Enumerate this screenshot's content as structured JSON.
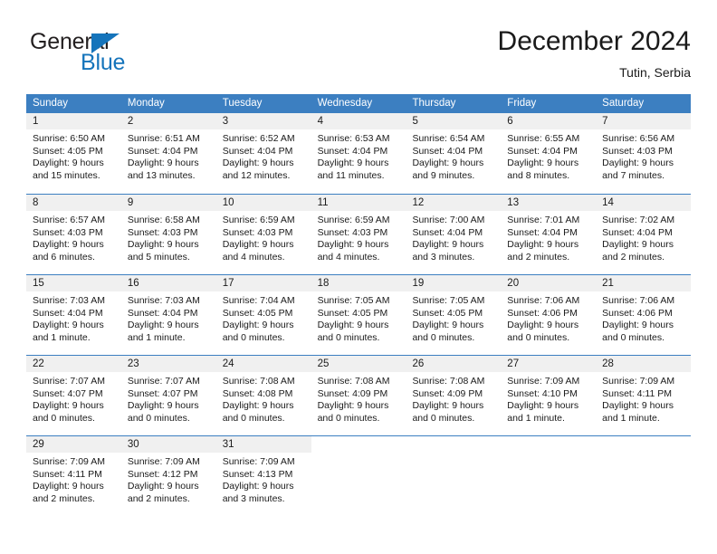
{
  "logo": {
    "primary_text": "General",
    "secondary_text": "Blue",
    "primary_color": "#231f20",
    "secondary_color": "#1574bb"
  },
  "header": {
    "month_title": "December 2024",
    "location": "Tutin, Serbia"
  },
  "theme": {
    "header_bg": "#3c7fc1",
    "header_text": "#ffffff",
    "day_band_bg": "#f0f0f0",
    "cell_bg": "#ffffff",
    "text": "#1a1a1a"
  },
  "calendar": {
    "weekdays": [
      "Sunday",
      "Monday",
      "Tuesday",
      "Wednesday",
      "Thursday",
      "Friday",
      "Saturday"
    ],
    "weeks": [
      [
        {
          "day": "1",
          "lines": [
            "Sunrise: 6:50 AM",
            "Sunset: 4:05 PM",
            "Daylight: 9 hours",
            "and 15 minutes."
          ]
        },
        {
          "day": "2",
          "lines": [
            "Sunrise: 6:51 AM",
            "Sunset: 4:04 PM",
            "Daylight: 9 hours",
            "and 13 minutes."
          ]
        },
        {
          "day": "3",
          "lines": [
            "Sunrise: 6:52 AM",
            "Sunset: 4:04 PM",
            "Daylight: 9 hours",
            "and 12 minutes."
          ]
        },
        {
          "day": "4",
          "lines": [
            "Sunrise: 6:53 AM",
            "Sunset: 4:04 PM",
            "Daylight: 9 hours",
            "and 11 minutes."
          ]
        },
        {
          "day": "5",
          "lines": [
            "Sunrise: 6:54 AM",
            "Sunset: 4:04 PM",
            "Daylight: 9 hours",
            "and 9 minutes."
          ]
        },
        {
          "day": "6",
          "lines": [
            "Sunrise: 6:55 AM",
            "Sunset: 4:04 PM",
            "Daylight: 9 hours",
            "and 8 minutes."
          ]
        },
        {
          "day": "7",
          "lines": [
            "Sunrise: 6:56 AM",
            "Sunset: 4:03 PM",
            "Daylight: 9 hours",
            "and 7 minutes."
          ]
        }
      ],
      [
        {
          "day": "8",
          "lines": [
            "Sunrise: 6:57 AM",
            "Sunset: 4:03 PM",
            "Daylight: 9 hours",
            "and 6 minutes."
          ]
        },
        {
          "day": "9",
          "lines": [
            "Sunrise: 6:58 AM",
            "Sunset: 4:03 PM",
            "Daylight: 9 hours",
            "and 5 minutes."
          ]
        },
        {
          "day": "10",
          "lines": [
            "Sunrise: 6:59 AM",
            "Sunset: 4:03 PM",
            "Daylight: 9 hours",
            "and 4 minutes."
          ]
        },
        {
          "day": "11",
          "lines": [
            "Sunrise: 6:59 AM",
            "Sunset: 4:03 PM",
            "Daylight: 9 hours",
            "and 4 minutes."
          ]
        },
        {
          "day": "12",
          "lines": [
            "Sunrise: 7:00 AM",
            "Sunset: 4:04 PM",
            "Daylight: 9 hours",
            "and 3 minutes."
          ]
        },
        {
          "day": "13",
          "lines": [
            "Sunrise: 7:01 AM",
            "Sunset: 4:04 PM",
            "Daylight: 9 hours",
            "and 2 minutes."
          ]
        },
        {
          "day": "14",
          "lines": [
            "Sunrise: 7:02 AM",
            "Sunset: 4:04 PM",
            "Daylight: 9 hours",
            "and 2 minutes."
          ]
        }
      ],
      [
        {
          "day": "15",
          "lines": [
            "Sunrise: 7:03 AM",
            "Sunset: 4:04 PM",
            "Daylight: 9 hours",
            "and 1 minute."
          ]
        },
        {
          "day": "16",
          "lines": [
            "Sunrise: 7:03 AM",
            "Sunset: 4:04 PM",
            "Daylight: 9 hours",
            "and 1 minute."
          ]
        },
        {
          "day": "17",
          "lines": [
            "Sunrise: 7:04 AM",
            "Sunset: 4:05 PM",
            "Daylight: 9 hours",
            "and 0 minutes."
          ]
        },
        {
          "day": "18",
          "lines": [
            "Sunrise: 7:05 AM",
            "Sunset: 4:05 PM",
            "Daylight: 9 hours",
            "and 0 minutes."
          ]
        },
        {
          "day": "19",
          "lines": [
            "Sunrise: 7:05 AM",
            "Sunset: 4:05 PM",
            "Daylight: 9 hours",
            "and 0 minutes."
          ]
        },
        {
          "day": "20",
          "lines": [
            "Sunrise: 7:06 AM",
            "Sunset: 4:06 PM",
            "Daylight: 9 hours",
            "and 0 minutes."
          ]
        },
        {
          "day": "21",
          "lines": [
            "Sunrise: 7:06 AM",
            "Sunset: 4:06 PM",
            "Daylight: 9 hours",
            "and 0 minutes."
          ]
        }
      ],
      [
        {
          "day": "22",
          "lines": [
            "Sunrise: 7:07 AM",
            "Sunset: 4:07 PM",
            "Daylight: 9 hours",
            "and 0 minutes."
          ]
        },
        {
          "day": "23",
          "lines": [
            "Sunrise: 7:07 AM",
            "Sunset: 4:07 PM",
            "Daylight: 9 hours",
            "and 0 minutes."
          ]
        },
        {
          "day": "24",
          "lines": [
            "Sunrise: 7:08 AM",
            "Sunset: 4:08 PM",
            "Daylight: 9 hours",
            "and 0 minutes."
          ]
        },
        {
          "day": "25",
          "lines": [
            "Sunrise: 7:08 AM",
            "Sunset: 4:09 PM",
            "Daylight: 9 hours",
            "and 0 minutes."
          ]
        },
        {
          "day": "26",
          "lines": [
            "Sunrise: 7:08 AM",
            "Sunset: 4:09 PM",
            "Daylight: 9 hours",
            "and 0 minutes."
          ]
        },
        {
          "day": "27",
          "lines": [
            "Sunrise: 7:09 AM",
            "Sunset: 4:10 PM",
            "Daylight: 9 hours",
            "and 1 minute."
          ]
        },
        {
          "day": "28",
          "lines": [
            "Sunrise: 7:09 AM",
            "Sunset: 4:11 PM",
            "Daylight: 9 hours",
            "and 1 minute."
          ]
        }
      ],
      [
        {
          "day": "29",
          "lines": [
            "Sunrise: 7:09 AM",
            "Sunset: 4:11 PM",
            "Daylight: 9 hours",
            "and 2 minutes."
          ]
        },
        {
          "day": "30",
          "lines": [
            "Sunrise: 7:09 AM",
            "Sunset: 4:12 PM",
            "Daylight: 9 hours",
            "and 2 minutes."
          ]
        },
        {
          "day": "31",
          "lines": [
            "Sunrise: 7:09 AM",
            "Sunset: 4:13 PM",
            "Daylight: 9 hours",
            "and 3 minutes."
          ]
        },
        {
          "day": "",
          "lines": []
        },
        {
          "day": "",
          "lines": []
        },
        {
          "day": "",
          "lines": []
        },
        {
          "day": "",
          "lines": []
        }
      ]
    ]
  }
}
